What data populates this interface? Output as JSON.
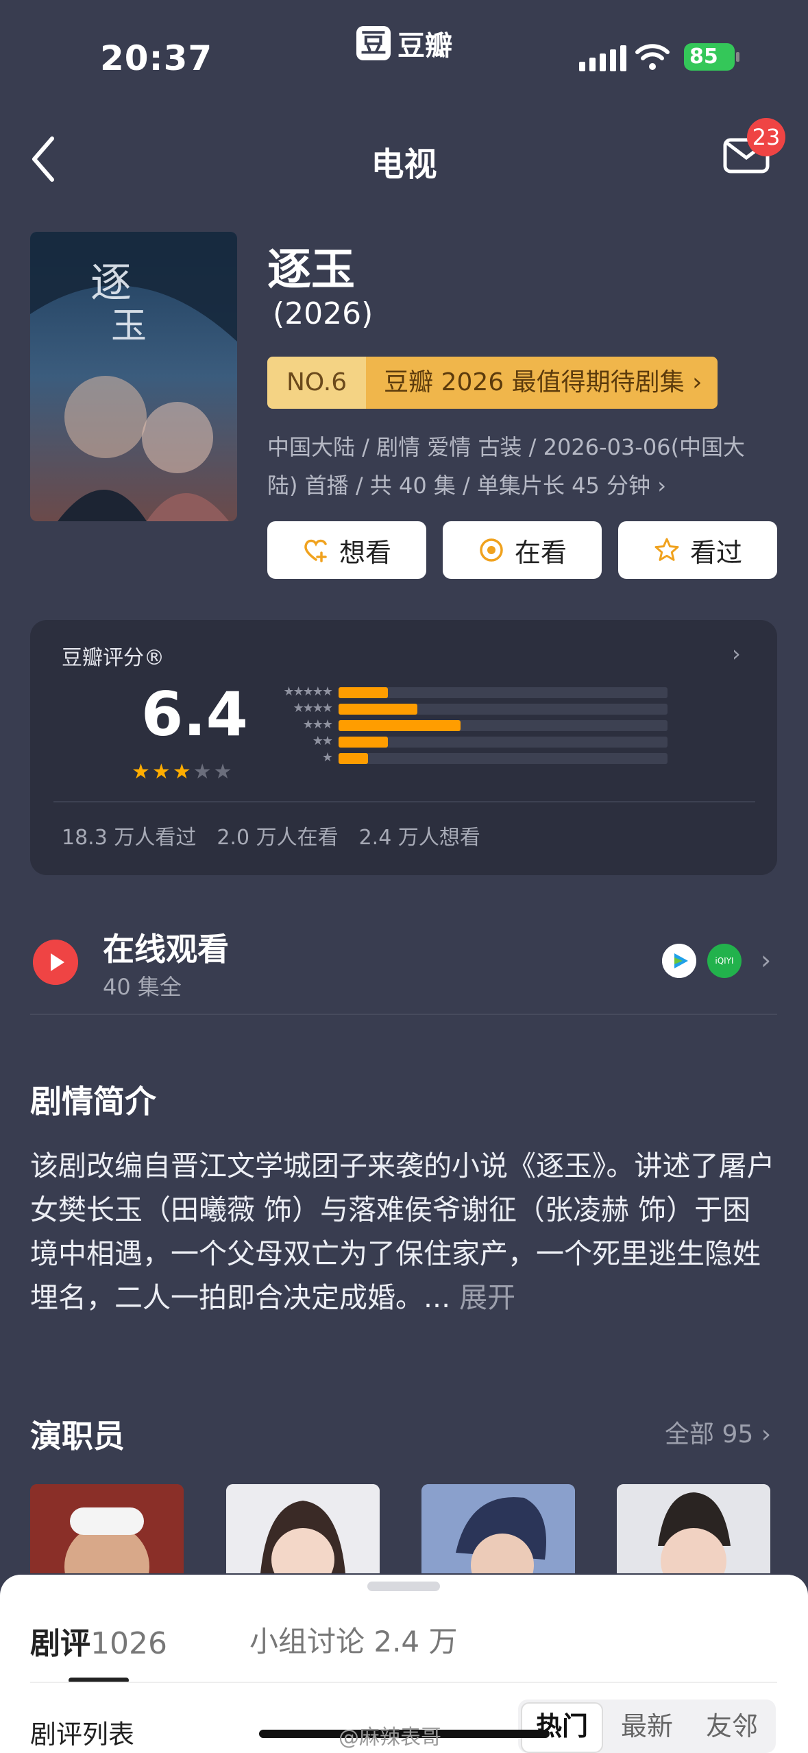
{
  "status_bar": {
    "time": "20:37",
    "app_name": "豆瓣",
    "app_logo": "豆",
    "battery": "85"
  },
  "nav": {
    "title": "电视",
    "mail_badge": "23"
  },
  "show": {
    "title": "逐玉",
    "year": "(2026)",
    "rank_no": "NO.6",
    "rank_text": "豆瓣 2026 最值得期待剧集 ›",
    "meta_line1": "中国大陆 / 剧情 爱情 古装 / 2026-03-06(中国大",
    "meta_line2": "陆) 首播 / 共 40 集 / 单集片长 45 分钟 ›"
  },
  "actions": [
    {
      "label": "想看",
      "icon": "heart-plus-icon"
    },
    {
      "label": "在看",
      "icon": "target-icon"
    },
    {
      "label": "看过",
      "icon": "star-outline-icon"
    }
  ],
  "rating": {
    "label": "豆瓣评分®",
    "score": "6.4",
    "stars_filled": 3,
    "stars_total": 5,
    "distribution": [
      0.15,
      0.24,
      0.37,
      0.15,
      0.09
    ],
    "stats": [
      "18.3 万人看过",
      "2.0 万人在看",
      "2.4 万人想看"
    ],
    "colors": {
      "bar": "#ff9d00",
      "track": "#3d4152",
      "star_on": "#ffad00",
      "star_off": "#6b6e7c"
    }
  },
  "watch": {
    "title": "在线观看",
    "sub": "40 集全",
    "providers": [
      "tencent-video-icon",
      "iqiyi-icon"
    ]
  },
  "synopsis": {
    "heading": "剧情简介",
    "text": "该剧改编自晋江文学城团子来袭的小说《逐玉》。讲述了屠户女樊长玉（田曦薇 饰）与落难侯爷谢征（张凌赫 饰）于困境中相遇，一个父母双亡为了保住家产，一个死里逃生隐姓埋名，二人一拍即合决定成婚。...",
    "more": " 展开"
  },
  "cast": {
    "heading": "演职员",
    "all_label": "全部 95 ›"
  },
  "sheet": {
    "tab1_label": "剧评",
    "tab1_count": "1026",
    "tab2_label": "小组讨论 2.4 万",
    "list_label": "剧评列表",
    "segments": [
      "热门",
      "最新",
      "友邻"
    ],
    "watermark": "@麻辣表哥"
  }
}
